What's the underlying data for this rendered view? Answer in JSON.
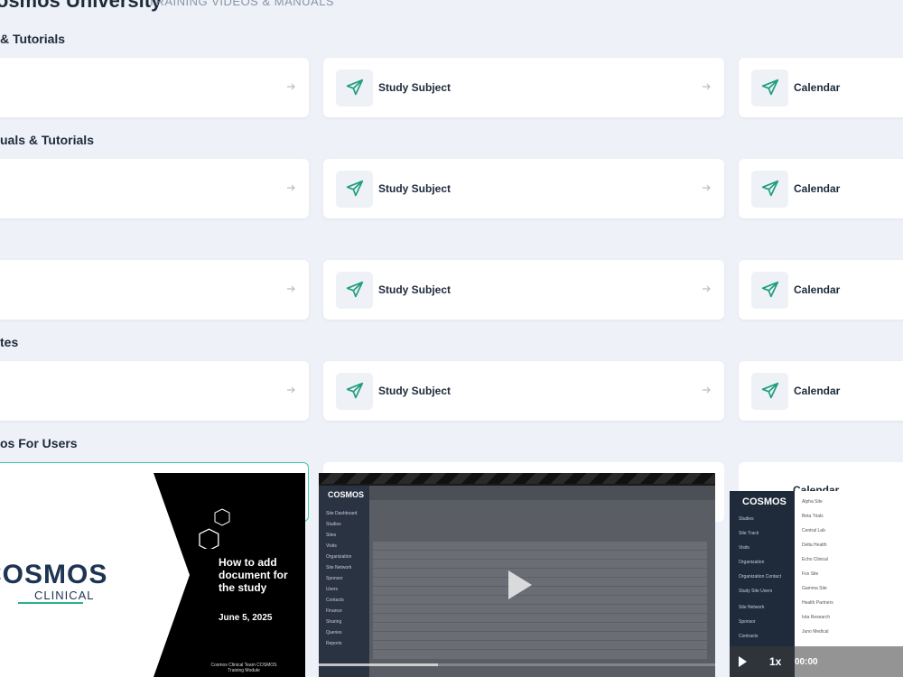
{
  "header": {
    "title": "Cosmos University",
    "subtitle": "TRAINING VIDEOS & MANUALS"
  },
  "sections": [
    {
      "heading": "& Tutorials",
      "cards": [
        "",
        "Study Subject",
        "Calendar"
      ]
    },
    {
      "heading": "uals & Tutorials",
      "cards": [
        "",
        "Study Subject",
        "Calendar"
      ]
    },
    {
      "heading": "",
      "cards": [
        "",
        "Study Subject",
        "Calendar"
      ]
    },
    {
      "heading": "tes",
      "cards": [
        "",
        "Study Subject",
        "Calendar"
      ]
    },
    {
      "heading": "os For Users",
      "cards": []
    }
  ],
  "videos": {
    "v1": {
      "logo": "COSMOS",
      "logo_sub": "CLINICAL",
      "title": "How to add document for the study",
      "date": "June 5, 2025",
      "footer": "Cosmos Clinical Team COSMOS Training Module"
    },
    "v2": {
      "logo": "COSMOS",
      "sidebar_items": [
        "Site Dashboard",
        "Studies",
        "Sites",
        "Visits",
        "Organization",
        "Site Network",
        "Sponsor",
        "Users",
        "Contacts",
        "Finance",
        "Sharing",
        "Queries",
        "Reports"
      ],
      "progress": 0.3
    },
    "v3": {
      "logo": "COSMOS",
      "sidebar_items": [
        "Studies",
        "Site Track",
        "Visits",
        "Organization",
        "Organization Contact",
        "Study Site Users",
        "Site Network",
        "Sponsor",
        "Contracts"
      ],
      "list_items": [
        "Alpha Site",
        "Beta Trials",
        "Central Lab",
        "Delta Health",
        "Echo Clinical",
        "Fox Site",
        "Gamma Site",
        "Health Partners",
        "Iota Research",
        "Juno Medical"
      ],
      "speed": "1x",
      "time": "00:00"
    },
    "behind_card_label": "Calendar"
  },
  "colors": {
    "accent": "#2bb08b",
    "background": "#eef1f7",
    "card": "#ffffff",
    "text": "#1d2a3a"
  }
}
